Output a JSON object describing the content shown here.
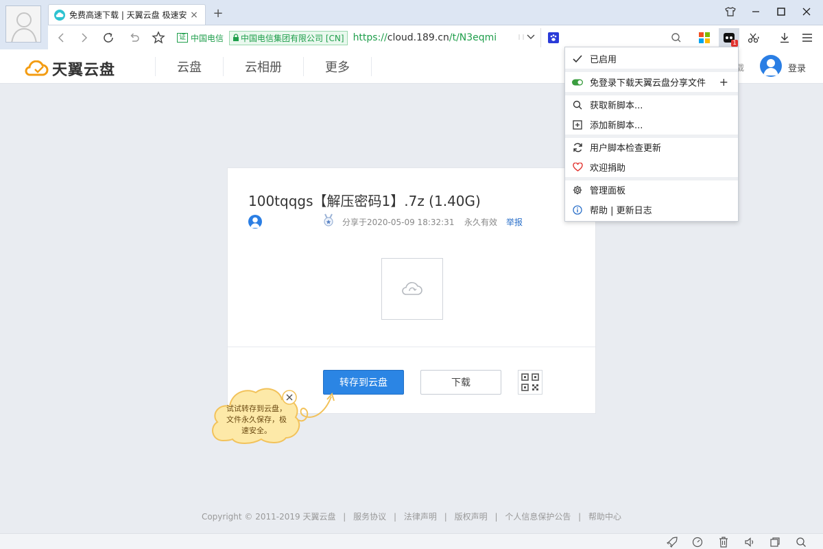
{
  "browser": {
    "tab_title": "免费高速下载 | 天翼云盘 极速安",
    "tab_close": "×",
    "new_tab": "+",
    "cert_badge": "证",
    "cert_label": "中国电信",
    "org_label": "中国电信集团有限公司 [CN]",
    "url_scheme": "https://",
    "url_host": "cloud.189.cn",
    "url_path": "/t/N3eqmi",
    "icons": [
      "user-avatar",
      "back",
      "forward",
      "reload",
      "undo",
      "star",
      "shirt",
      "minimize",
      "maximize",
      "close",
      "dropdown",
      "paw",
      "search",
      "apps",
      "userscript",
      "scissors",
      "download",
      "menu"
    ],
    "userscript_badge": "1"
  },
  "site": {
    "logo_text": "天翼云盘",
    "nav": [
      "云盘",
      "云相册",
      "更多"
    ],
    "header_partial": "载",
    "login": "登录"
  },
  "file": {
    "title": "100tqqgs【解压密码1】.7z (1.40G)",
    "shared_at": "分享于2020-05-09 18:32:31",
    "validity": "永久有效",
    "report": "举报",
    "save_button": "转存到云盘",
    "download_button": "下载"
  },
  "tip": {
    "lines": [
      "试试转存到云盘，",
      "文件永久保存，极",
      "速安全。"
    ]
  },
  "menu": {
    "items": [
      {
        "label": "已启用",
        "icon": "check-icon"
      },
      {
        "label": "免登录下载天翼云盘分享文件",
        "icon": "toggle-on-icon",
        "extra": "+"
      },
      {
        "label": "获取新脚本...",
        "icon": "search-icon"
      },
      {
        "label": "添加新脚本...",
        "icon": "plus-square-icon"
      },
      {
        "label": "用户脚本检查更新",
        "icon": "refresh-icon"
      },
      {
        "label": "欢迎捐助",
        "icon": "heart-icon"
      },
      {
        "label": "管理面板",
        "icon": "gear-icon"
      },
      {
        "label": "帮助 | 更新日志",
        "icon": "info-icon"
      }
    ]
  },
  "footer": {
    "copyright": "Copyright © 2011-2019 天翼云盘",
    "links": [
      "服务协议",
      "法律声明",
      "版权声明",
      "个人信息保护公告",
      "帮助中心"
    ],
    "separator": "|"
  },
  "colors": {
    "primary": "#2b85e4",
    "secure_green": "#1f9e4b",
    "tip_fill": "#fde9a8",
    "tip_stroke": "#f2c25a",
    "heart_red": "#e2332f"
  }
}
